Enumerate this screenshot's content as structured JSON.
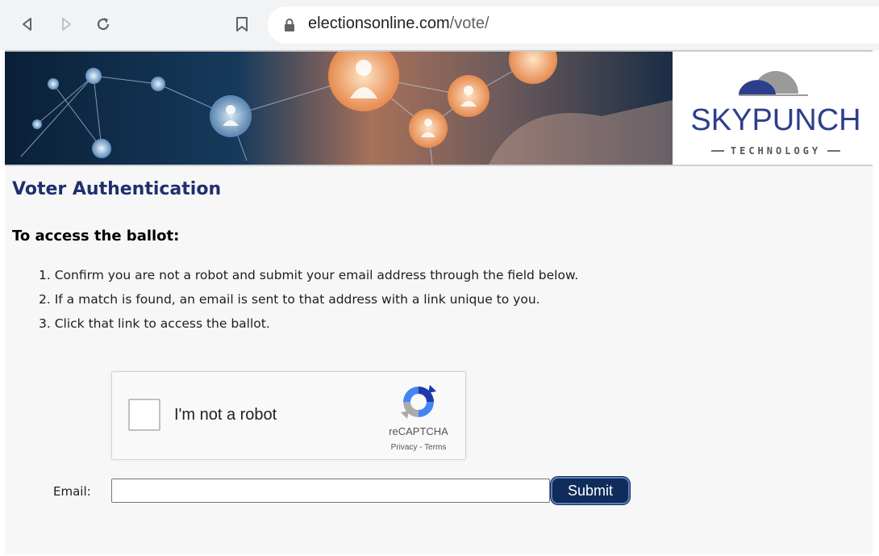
{
  "browser": {
    "url_domain": "electionsonline.com",
    "url_path": "/vote/"
  },
  "logo": {
    "name": "SKYPUNCH",
    "tagline": "TECHNOLOGY"
  },
  "page": {
    "title": "Voter Authentication",
    "subtitle": "To access the ballot:",
    "steps": [
      "1. Confirm you are not a robot and submit your email address through the field below.",
      "2. If a match is found, an email is sent to that address with a link unique to you.",
      "3. Click that link to access the ballot."
    ]
  },
  "captcha": {
    "label": "I'm not a robot",
    "brand": "reCAPTCHA",
    "privacy": "Privacy",
    "separator": " - ",
    "terms": "Terms",
    "checked": false
  },
  "form": {
    "email_label": "Email:",
    "email_value": "",
    "submit_label": "Submit"
  },
  "colors": {
    "heading": "#1f2f6e",
    "logo_blue": "#2d3f8c",
    "submit_bg": "#0f2c5a"
  }
}
